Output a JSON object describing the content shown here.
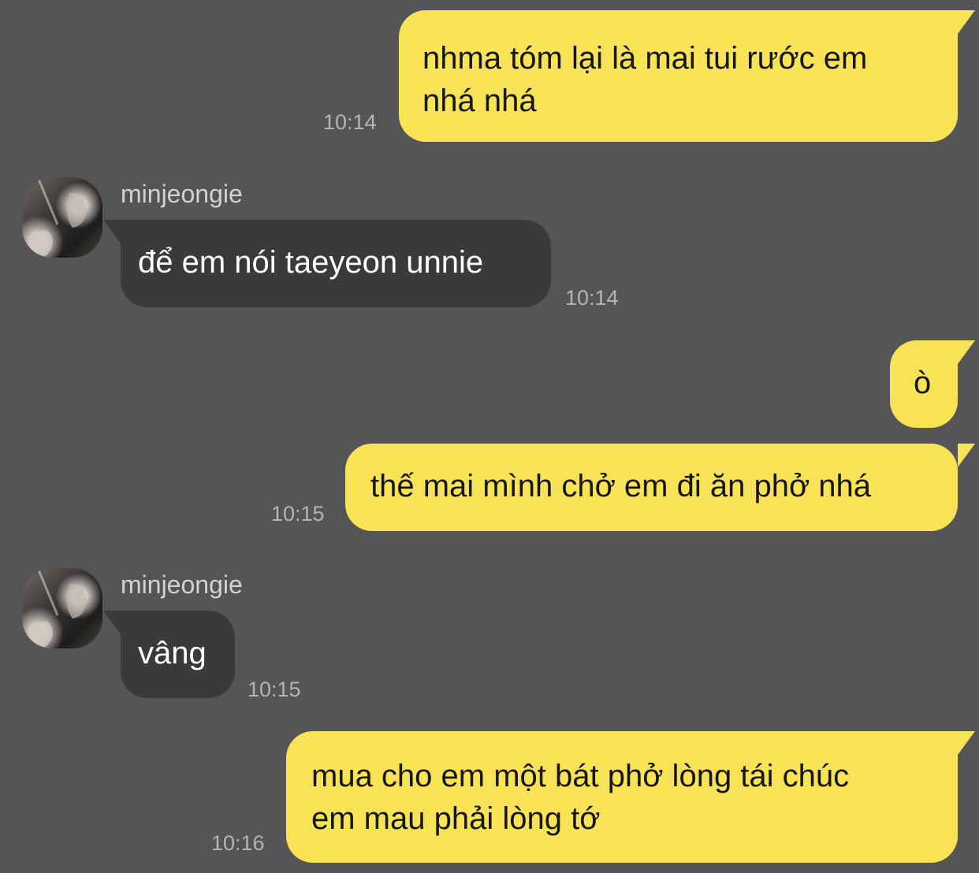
{
  "messages": [
    {
      "from": "me",
      "text": "nhma tóm lại là mai tui rước em\nnhá nhá",
      "time": "10:14"
    },
    {
      "from": "them",
      "sender": "minjeongie",
      "text": "để em nói taeyeon unnie",
      "time": "10:14"
    },
    {
      "from": "me",
      "text": "ò",
      "time": ""
    },
    {
      "from": "me",
      "text": "thế mai mình chở em đi ăn phở nhá",
      "time": "10:15"
    },
    {
      "from": "them",
      "sender": "minjeongie",
      "text": "vâng",
      "time": "10:15"
    },
    {
      "from": "me",
      "text": "mua cho em một bát phở lòng tái chúc\nem mau phải lòng tớ",
      "time": "10:16"
    }
  ],
  "colors": {
    "background": "#555456",
    "my_bubble": "#f7e355",
    "their_bubble": "#3a3a3c",
    "timestamp": "#b4b4b6"
  },
  "icons": {
    "avatar": "profile-photo-avatar"
  }
}
